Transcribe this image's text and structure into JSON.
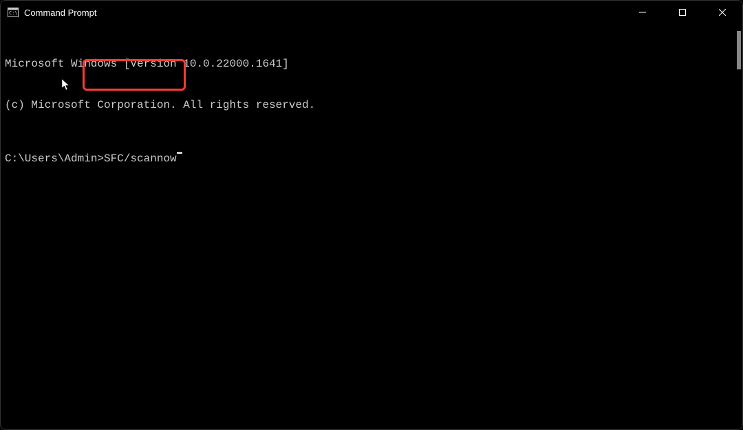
{
  "window": {
    "title": "Command Prompt"
  },
  "terminal": {
    "line1": "Microsoft Windows [Version 10.0.22000.1641]",
    "line2": "(c) Microsoft Corporation. All rights reserved.",
    "prompt_path": "C:\\Users\\Admin>",
    "command": "SFC/scannow"
  },
  "annotation": {
    "highlight_color": "#ff3b30"
  }
}
